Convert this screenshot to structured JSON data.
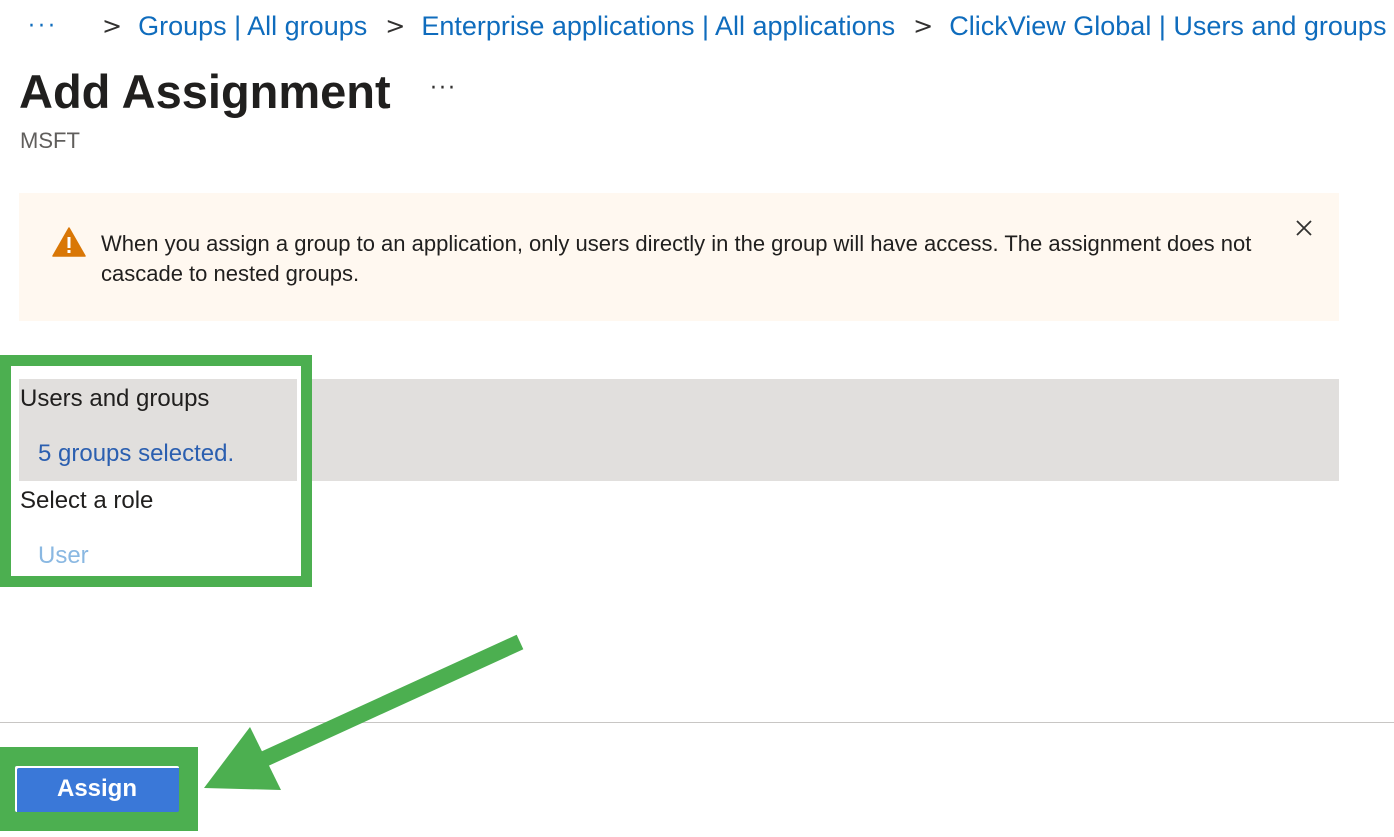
{
  "breadcrumb": {
    "overflow": "···",
    "separator": ">",
    "items": [
      {
        "label": "Groups | All groups"
      },
      {
        "label": "Enterprise applications | All applications"
      },
      {
        "label": "ClickView Global | Users and groups"
      }
    ],
    "trailing_separator": ">"
  },
  "page": {
    "title": "Add Assignment",
    "more": "···",
    "subtitle": "MSFT"
  },
  "warning": {
    "text": "When you assign a group to an application, only users directly in the group will have access. The assignment does not cascade to nested groups.",
    "icon": "warning-triangle-icon",
    "color": "#d97706"
  },
  "users_and_groups": {
    "label": "Users and groups",
    "value": "5 groups selected.",
    "value_color": "#2b5fb0"
  },
  "role": {
    "label": "Select a role",
    "value": "User",
    "value_color": "#8ab8e2"
  },
  "footer": {
    "assign_label": "Assign"
  },
  "annotation": {
    "highlight_color": "#4caf50"
  }
}
